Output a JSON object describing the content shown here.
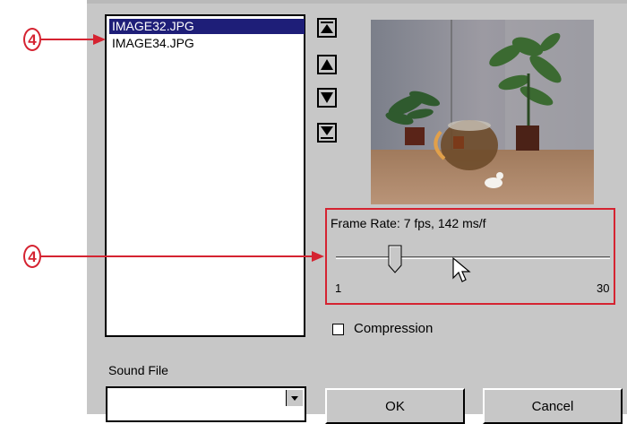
{
  "files": {
    "items": [
      {
        "name": "IMAGE32.JPG",
        "selected": true
      },
      {
        "name": "IMAGE34.JPG",
        "selected": false
      }
    ]
  },
  "order_buttons": [
    "move-to-top-icon",
    "move-up-icon",
    "move-down-icon",
    "move-to-bottom-icon"
  ],
  "frame_rate": {
    "label": "Frame Rate: 7 fps, 142 ms/f",
    "min": "1",
    "max": "30",
    "value": 7
  },
  "compression": {
    "label": "Compression",
    "checked": false
  },
  "sound": {
    "label": "Sound File",
    "value": ""
  },
  "buttons": {
    "ok": "OK",
    "cancel": "Cancel"
  },
  "callouts": [
    "4",
    "4"
  ],
  "colors": {
    "dialog_bg": "#c7c7c7",
    "selection": "#1e1e78",
    "callout": "#d52331"
  }
}
